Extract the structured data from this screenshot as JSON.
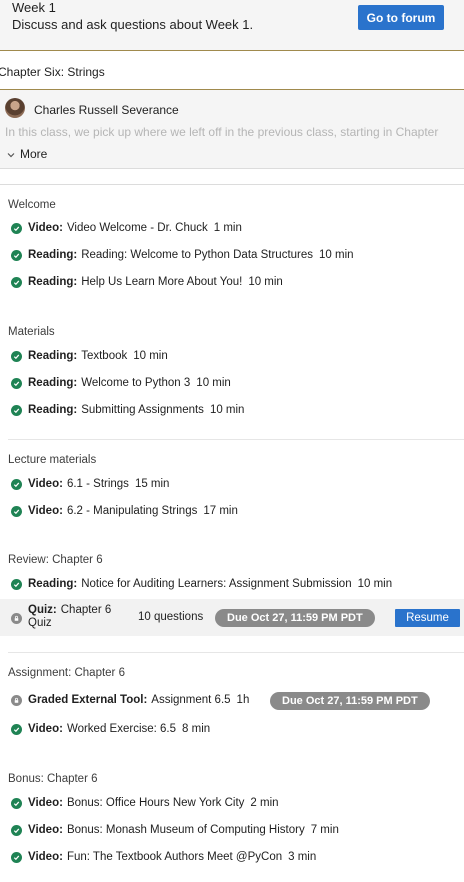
{
  "forum": {
    "title": "Week 1",
    "description": "Discuss and ask questions about Week 1.",
    "button_label": "Go to forum"
  },
  "chapter": {
    "title": "Chapter Six: Strings"
  },
  "author": {
    "name": "Charles Russell Severance",
    "excerpt": "In this class, we pick up where we left off in the previous class, starting in Chapter",
    "more_label": "More"
  },
  "sections": [
    {
      "title": "Welcome",
      "items": [
        {
          "type": "Video:",
          "name": "Video Welcome - Dr. Chuck",
          "duration": "1 min"
        },
        {
          "type": "Reading:",
          "name": "Reading: Welcome to Python Data Structures",
          "duration": "10 min"
        },
        {
          "type": "Reading:",
          "name": "Help Us Learn More About You!",
          "duration": "10 min"
        }
      ]
    },
    {
      "title": "Materials",
      "items": [
        {
          "type": "Reading:",
          "name": "Textbook",
          "duration": "10 min"
        },
        {
          "type": "Reading:",
          "name": "Welcome to Python 3",
          "duration": "10 min"
        },
        {
          "type": "Reading:",
          "name": "Submitting Assignments",
          "duration": "10 min"
        }
      ]
    },
    {
      "title": "Lecture materials",
      "items": [
        {
          "type": "Video:",
          "name": "6.1 - Strings",
          "duration": "15 min"
        },
        {
          "type": "Video:",
          "name": "6.2 - Manipulating Strings",
          "duration": "17 min"
        }
      ]
    },
    {
      "title": "Review: Chapter 6",
      "items": [
        {
          "type": "Reading:",
          "name": "Notice for Auditing Learners: Assignment Submission",
          "duration": "10 min"
        }
      ],
      "quiz": {
        "type": "Quiz:",
        "name": "Chapter 6",
        "subtitle": "Quiz",
        "count": "10 questions",
        "due": "Due Oct 27, 11:59 PM PDT",
        "resume_label": "Resume"
      }
    },
    {
      "title": "Assignment: Chapter 6",
      "items": [
        {
          "type": "Graded External Tool:",
          "name": "Assignment 6.5",
          "duration": "1h",
          "due": "Due Oct 27, 11:59 PM PDT"
        },
        {
          "type": "Video:",
          "name": "Worked Exercise: 6.5",
          "duration": "8 min"
        }
      ]
    },
    {
      "title": "Bonus: Chapter 6",
      "items": [
        {
          "type": "Video:",
          "name": "Bonus: Office Hours New York City",
          "duration": "2 min"
        },
        {
          "type": "Video:",
          "name": "Bonus: Monash Museum of Computing History",
          "duration": "7 min"
        },
        {
          "type": "Video:",
          "name": "Fun: The Textbook Authors Meet @PyCon",
          "duration": "3 min"
        }
      ]
    }
  ],
  "colors": {
    "accent_blue": "#2a73cc",
    "complete_green": "#1f8354",
    "due_badge_grey": "#8a8a8a",
    "divider_gold": "#a08a4d"
  },
  "icons": {
    "complete": "check-circle-icon",
    "locked": "lock-icon",
    "expand": "chevron-down-icon"
  }
}
